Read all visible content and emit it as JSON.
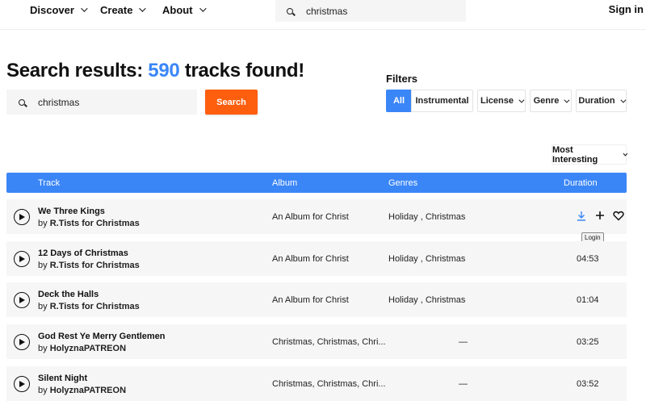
{
  "nav": {
    "items": [
      {
        "label": "Discover"
      },
      {
        "label": "Create"
      },
      {
        "label": "About"
      }
    ],
    "search": {
      "value": "christmas",
      "icon": "search-icon"
    },
    "signin_label": "Sign in"
  },
  "heading": {
    "prefix": "Search results: ",
    "count": "590",
    "suffix": " tracks found!"
  },
  "search": {
    "value": "christmas",
    "button_label": "Search"
  },
  "filters": {
    "label": "Filters",
    "buttons": [
      {
        "label": "All",
        "active": true
      },
      {
        "label": "Instrumental"
      },
      {
        "label": "License"
      },
      {
        "label": "Genre"
      },
      {
        "label": "Duration"
      }
    ]
  },
  "sort": {
    "selected": "Most Interesting"
  },
  "table": {
    "headers": {
      "track": "Track",
      "album": "Album",
      "genres": "Genres",
      "duration": "Duration"
    },
    "rows": [
      {
        "title": "We Three Kings",
        "by": "by ",
        "artist": "R.Tists for Christmas",
        "album": "An Album for Christ",
        "genres": "Holiday , Christmas",
        "duration": "",
        "hovered": true
      },
      {
        "title": "12 Days of Christmas",
        "by": "by ",
        "artist": "R.Tists for Christmas",
        "album": "An Album for Christ",
        "genres": "Holiday , Christmas",
        "duration": "04:53"
      },
      {
        "title": "Deck the Halls",
        "by": "by ",
        "artist": "R.Tists for Christmas",
        "album": "An Album for Christ",
        "genres": "Holiday , Christmas",
        "duration": "01:04"
      },
      {
        "title": "God Rest Ye Merry Gentlemen",
        "by": "by ",
        "artist": "HolyznaPATREON",
        "album": "Christmas, Christmas, Chri...",
        "genres": "—",
        "duration": "03:25"
      },
      {
        "title": "Silent Night",
        "by": "by ",
        "artist": "HolyznaPATREON",
        "album": "Christmas, Christmas, Chri...",
        "genres": "—",
        "duration": "03:52"
      }
    ],
    "tooltip": "Login"
  },
  "colors": {
    "accent": "#3b86f7",
    "search_button": "#fd5f0f"
  }
}
